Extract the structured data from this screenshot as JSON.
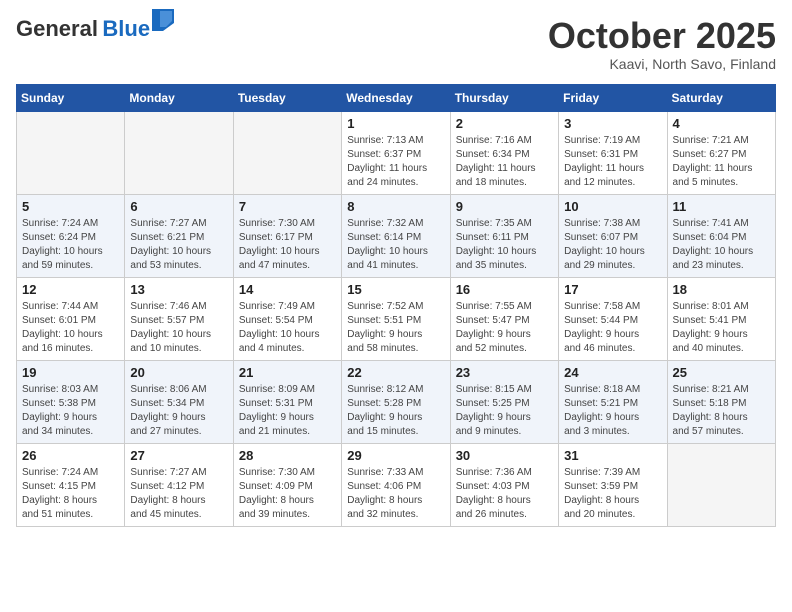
{
  "header": {
    "logo_general": "General",
    "logo_blue": "Blue",
    "month": "October 2025",
    "location": "Kaavi, North Savo, Finland"
  },
  "weekdays": [
    "Sunday",
    "Monday",
    "Tuesday",
    "Wednesday",
    "Thursday",
    "Friday",
    "Saturday"
  ],
  "weeks": [
    [
      {
        "day": "",
        "info": ""
      },
      {
        "day": "",
        "info": ""
      },
      {
        "day": "",
        "info": ""
      },
      {
        "day": "1",
        "info": "Sunrise: 7:13 AM\nSunset: 6:37 PM\nDaylight: 11 hours\nand 24 minutes."
      },
      {
        "day": "2",
        "info": "Sunrise: 7:16 AM\nSunset: 6:34 PM\nDaylight: 11 hours\nand 18 minutes."
      },
      {
        "day": "3",
        "info": "Sunrise: 7:19 AM\nSunset: 6:31 PM\nDaylight: 11 hours\nand 12 minutes."
      },
      {
        "day": "4",
        "info": "Sunrise: 7:21 AM\nSunset: 6:27 PM\nDaylight: 11 hours\nand 5 minutes."
      }
    ],
    [
      {
        "day": "5",
        "info": "Sunrise: 7:24 AM\nSunset: 6:24 PM\nDaylight: 10 hours\nand 59 minutes."
      },
      {
        "day": "6",
        "info": "Sunrise: 7:27 AM\nSunset: 6:21 PM\nDaylight: 10 hours\nand 53 minutes."
      },
      {
        "day": "7",
        "info": "Sunrise: 7:30 AM\nSunset: 6:17 PM\nDaylight: 10 hours\nand 47 minutes."
      },
      {
        "day": "8",
        "info": "Sunrise: 7:32 AM\nSunset: 6:14 PM\nDaylight: 10 hours\nand 41 minutes."
      },
      {
        "day": "9",
        "info": "Sunrise: 7:35 AM\nSunset: 6:11 PM\nDaylight: 10 hours\nand 35 minutes."
      },
      {
        "day": "10",
        "info": "Sunrise: 7:38 AM\nSunset: 6:07 PM\nDaylight: 10 hours\nand 29 minutes."
      },
      {
        "day": "11",
        "info": "Sunrise: 7:41 AM\nSunset: 6:04 PM\nDaylight: 10 hours\nand 23 minutes."
      }
    ],
    [
      {
        "day": "12",
        "info": "Sunrise: 7:44 AM\nSunset: 6:01 PM\nDaylight: 10 hours\nand 16 minutes."
      },
      {
        "day": "13",
        "info": "Sunrise: 7:46 AM\nSunset: 5:57 PM\nDaylight: 10 hours\nand 10 minutes."
      },
      {
        "day": "14",
        "info": "Sunrise: 7:49 AM\nSunset: 5:54 PM\nDaylight: 10 hours\nand 4 minutes."
      },
      {
        "day": "15",
        "info": "Sunrise: 7:52 AM\nSunset: 5:51 PM\nDaylight: 9 hours\nand 58 minutes."
      },
      {
        "day": "16",
        "info": "Sunrise: 7:55 AM\nSunset: 5:47 PM\nDaylight: 9 hours\nand 52 minutes."
      },
      {
        "day": "17",
        "info": "Sunrise: 7:58 AM\nSunset: 5:44 PM\nDaylight: 9 hours\nand 46 minutes."
      },
      {
        "day": "18",
        "info": "Sunrise: 8:01 AM\nSunset: 5:41 PM\nDaylight: 9 hours\nand 40 minutes."
      }
    ],
    [
      {
        "day": "19",
        "info": "Sunrise: 8:03 AM\nSunset: 5:38 PM\nDaylight: 9 hours\nand 34 minutes."
      },
      {
        "day": "20",
        "info": "Sunrise: 8:06 AM\nSunset: 5:34 PM\nDaylight: 9 hours\nand 27 minutes."
      },
      {
        "day": "21",
        "info": "Sunrise: 8:09 AM\nSunset: 5:31 PM\nDaylight: 9 hours\nand 21 minutes."
      },
      {
        "day": "22",
        "info": "Sunrise: 8:12 AM\nSunset: 5:28 PM\nDaylight: 9 hours\nand 15 minutes."
      },
      {
        "day": "23",
        "info": "Sunrise: 8:15 AM\nSunset: 5:25 PM\nDaylight: 9 hours\nand 9 minutes."
      },
      {
        "day": "24",
        "info": "Sunrise: 8:18 AM\nSunset: 5:21 PM\nDaylight: 9 hours\nand 3 minutes."
      },
      {
        "day": "25",
        "info": "Sunrise: 8:21 AM\nSunset: 5:18 PM\nDaylight: 8 hours\nand 57 minutes."
      }
    ],
    [
      {
        "day": "26",
        "info": "Sunrise: 7:24 AM\nSunset: 4:15 PM\nDaylight: 8 hours\nand 51 minutes."
      },
      {
        "day": "27",
        "info": "Sunrise: 7:27 AM\nSunset: 4:12 PM\nDaylight: 8 hours\nand 45 minutes."
      },
      {
        "day": "28",
        "info": "Sunrise: 7:30 AM\nSunset: 4:09 PM\nDaylight: 8 hours\nand 39 minutes."
      },
      {
        "day": "29",
        "info": "Sunrise: 7:33 AM\nSunset: 4:06 PM\nDaylight: 8 hours\nand 32 minutes."
      },
      {
        "day": "30",
        "info": "Sunrise: 7:36 AM\nSunset: 4:03 PM\nDaylight: 8 hours\nand 26 minutes."
      },
      {
        "day": "31",
        "info": "Sunrise: 7:39 AM\nSunset: 3:59 PM\nDaylight: 8 hours\nand 20 minutes."
      },
      {
        "day": "",
        "info": ""
      }
    ]
  ]
}
